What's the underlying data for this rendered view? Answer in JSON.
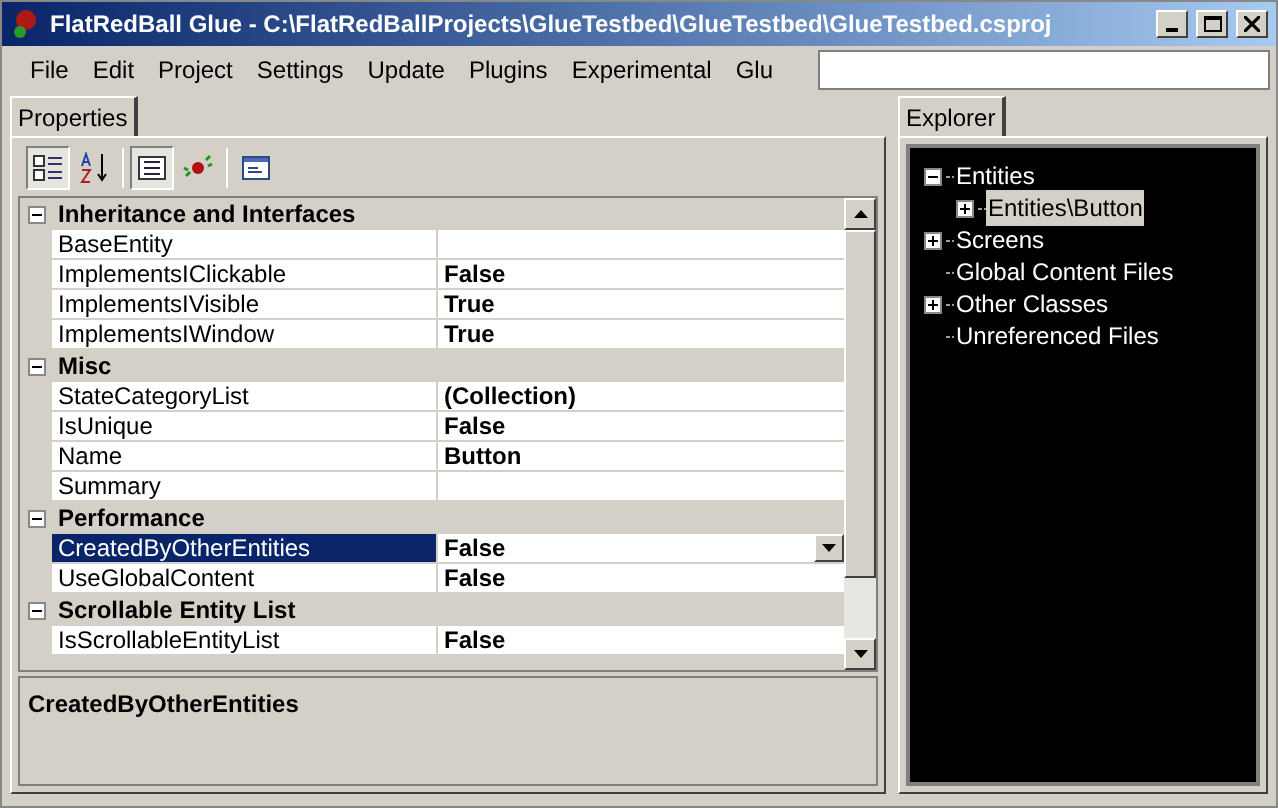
{
  "window": {
    "title": "FlatRedBall Glue - C:\\FlatRedBallProjects\\GlueTestbed\\GlueTestbed\\GlueTestbed.csproj"
  },
  "menu": [
    "File",
    "Edit",
    "Project",
    "Settings",
    "Update",
    "Plugins",
    "Experimental",
    "Glu"
  ],
  "left_tabs": [
    {
      "label": "Properties",
      "selected": true
    }
  ],
  "toolbar": [
    {
      "kind": "categorized",
      "selected": true
    },
    {
      "kind": "alphabetical",
      "selected": false
    },
    {
      "kind": "properties",
      "selected": true
    },
    {
      "kind": "events",
      "selected": false
    },
    {
      "kind": "pages",
      "selected": false
    }
  ],
  "property_grid": {
    "categories": [
      {
        "name": "Inheritance and Interfaces",
        "expanded": true,
        "rows": [
          {
            "name": "BaseEntity",
            "value": "",
            "selected": false
          },
          {
            "name": "ImplementsIClickable",
            "value": "False",
            "selected": false
          },
          {
            "name": "ImplementsIVisible",
            "value": "True",
            "selected": false
          },
          {
            "name": "ImplementsIWindow",
            "value": "True",
            "selected": false
          }
        ]
      },
      {
        "name": "Misc",
        "expanded": true,
        "rows": [
          {
            "name": "StateCategoryList",
            "value": "(Collection)",
            "selected": false
          },
          {
            "name": "IsUnique",
            "value": "False",
            "selected": false
          },
          {
            "name": "Name",
            "value": "Button",
            "selected": false
          },
          {
            "name": "Summary",
            "value": "",
            "selected": false
          }
        ]
      },
      {
        "name": "Performance",
        "expanded": true,
        "rows": [
          {
            "name": "CreatedByOtherEntities",
            "value": "False",
            "selected": true
          },
          {
            "name": "UseGlobalContent",
            "value": "False",
            "selected": false
          }
        ]
      },
      {
        "name": "Scrollable Entity List",
        "expanded": true,
        "rows": [
          {
            "name": "IsScrollableEntityList",
            "value": "False",
            "selected": false
          }
        ]
      }
    ]
  },
  "description": {
    "title": "CreatedByOtherEntities"
  },
  "right_tabs": [
    {
      "label": "Explorer",
      "selected": true
    }
  ],
  "explorer": {
    "items": [
      {
        "label": "Entities",
        "expanded": true,
        "selected": false,
        "children": [
          {
            "label": "Entities\\Button",
            "expanded": false,
            "selected": true
          }
        ]
      },
      {
        "label": "Screens",
        "expanded": false,
        "selected": false
      },
      {
        "label": "Global Content Files",
        "selected": false
      },
      {
        "label": "Other Classes",
        "expanded": false,
        "selected": false
      },
      {
        "label": "Unreferenced Files",
        "selected": false
      }
    ]
  }
}
